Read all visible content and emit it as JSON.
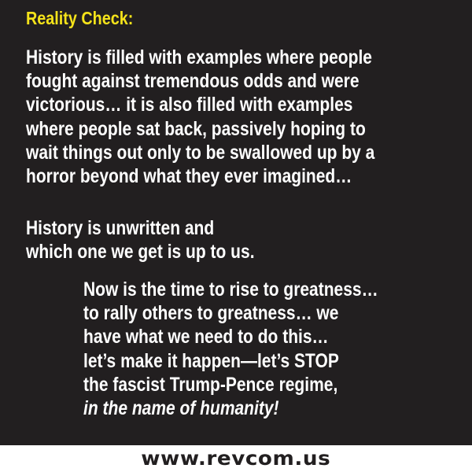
{
  "heading": "Reality Check:",
  "paragraph1": [
    "History is filled with examples where people",
    "fought against tremendous odds and were",
    "victorious… it is also filled with examples",
    "where people sat back, passively hoping to",
    "wait things out only to be swallowed up by a",
    "horror beyond what they ever imagined…"
  ],
  "paragraph2": [
    "History is unwritten and",
    "which one we get is up to us."
  ],
  "paragraph3": [
    "Now is the time to rise to greatness…",
    "to rally others to greatness… we",
    "have what we need to do this…",
    "let’s make it happen—let’s STOP",
    "the fascist Trump-Pence regime,"
  ],
  "closing": "in the name of humanity!",
  "website": "www.revcom.us",
  "colors": {
    "background": "#221f20",
    "heading": "#f5e31a",
    "text": "#ffffff",
    "footer_text": "#221f20"
  }
}
